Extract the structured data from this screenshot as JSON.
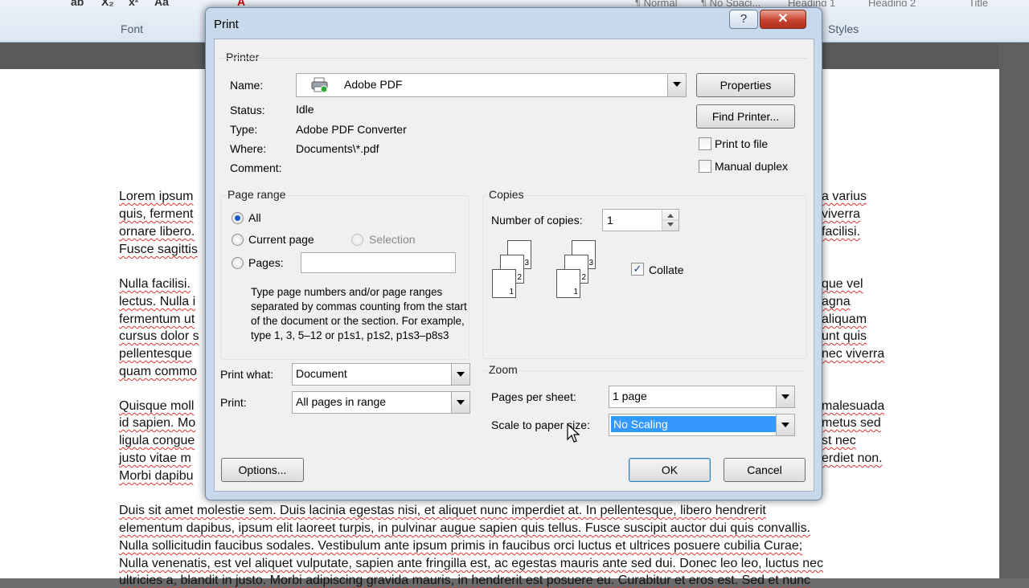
{
  "app": {
    "ribbon_font_group": "Font",
    "ribbon_styles_group": "Styles",
    "style_gallery": [
      "¶ Normal",
      "¶ No Spaci...",
      "Heading 1",
      "Heading 2",
      "Title"
    ],
    "toolbar_glyphs": [
      "ab",
      "X₂",
      "x²",
      "Aa",
      "A"
    ]
  },
  "document": {
    "left_lines": [
      "Lorem ipsum",
      "quis, ferment",
      "ornare libero.",
      "Fusce sagittis",
      "Nulla facilisi.",
      "lectus. Nulla i",
      "fermentum ut",
      "cursus dolor s",
      "pellentesque",
      "quam commo",
      "Quisque moll",
      "id sapien. Mo",
      "ligula congue",
      "justo vitae m",
      "Morbi dapibu"
    ],
    "right_lines": [
      "a varius",
      "viverra",
      "facilisi.",
      "que vel",
      "agna",
      "aliquam",
      "unt quis",
      "nec viverra",
      "malesuada",
      "metus sed",
      "st nec",
      "erdiet non."
    ],
    "full_lines": [
      "Duis sit amet molestie sem. Duis lacinia egestas nisi, et aliquet nunc imperdiet at. In pellentesque, libero hendrerit",
      "elementum dapibus, ipsum elit laoreet turpis, in pulvinar augue sapien quis tellus. Fusce suscipit auctor dui quis convallis.",
      "Nulla sollicitudin faucibus sodales. Vestibulum ante ipsum primis in faucibus orci luctus et ultrices posuere cubilia Curae;",
      "Nulla venenatis, est vel aliquet vulputate, sapien ante fringilla est, ac egestas mauris ante sed dui. Donec leo leo, luctus nec",
      "ultricies a, blandit in justo. Morbi adipiscing gravida mauris, in hendrerit est posuere eu. Curabitur et eros est. Sed et nunc"
    ]
  },
  "dialog": {
    "title": "Print",
    "help_glyph": "?",
    "close_glyph": "✕",
    "printer": {
      "group_label": "Printer",
      "name_label": "Name:",
      "name_value": "Adobe PDF",
      "status_label": "Status:",
      "status_value": "Idle",
      "type_label": "Type:",
      "type_value": "Adobe PDF Converter",
      "where_label": "Where:",
      "where_value": "Documents\\*.pdf",
      "comment_label": "Comment:",
      "comment_value": "",
      "properties_button": "Properties",
      "find_printer_button": "Find Printer...",
      "print_to_file_label": "Print to file",
      "print_to_file_checked": false,
      "manual_duplex_label": "Manual duplex",
      "manual_duplex_checked": false
    },
    "page_range": {
      "group_label": "Page range",
      "all_label": "All",
      "current_page_label": "Current page",
      "selection_label": "Selection",
      "pages_label": "Pages:",
      "pages_value": "",
      "selected": "all",
      "help_text": "Type page numbers and/or page ranges separated by commas counting from the start of the document or the section. For example, type 1, 3, 5–12 or p1s1, p1s2, p1s3–p8s3"
    },
    "print_what": {
      "label": "Print what:",
      "value": "Document"
    },
    "print": {
      "label": "Print:",
      "value": "All pages in range"
    },
    "copies": {
      "group_label": "Copies",
      "number_label": "Number of copies:",
      "number_value": "1",
      "collate_label": "Collate",
      "collate_checked": true,
      "sheet_numbers": [
        "3",
        "2",
        "1"
      ]
    },
    "zoom": {
      "group_label": "Zoom",
      "pages_per_sheet_label": "Pages per sheet:",
      "pages_per_sheet_value": "1 page",
      "scale_label": "Scale to paper size:",
      "scale_value": "No Scaling"
    },
    "options_button": "Options...",
    "ok_button": "OK",
    "cancel_button": "Cancel"
  }
}
